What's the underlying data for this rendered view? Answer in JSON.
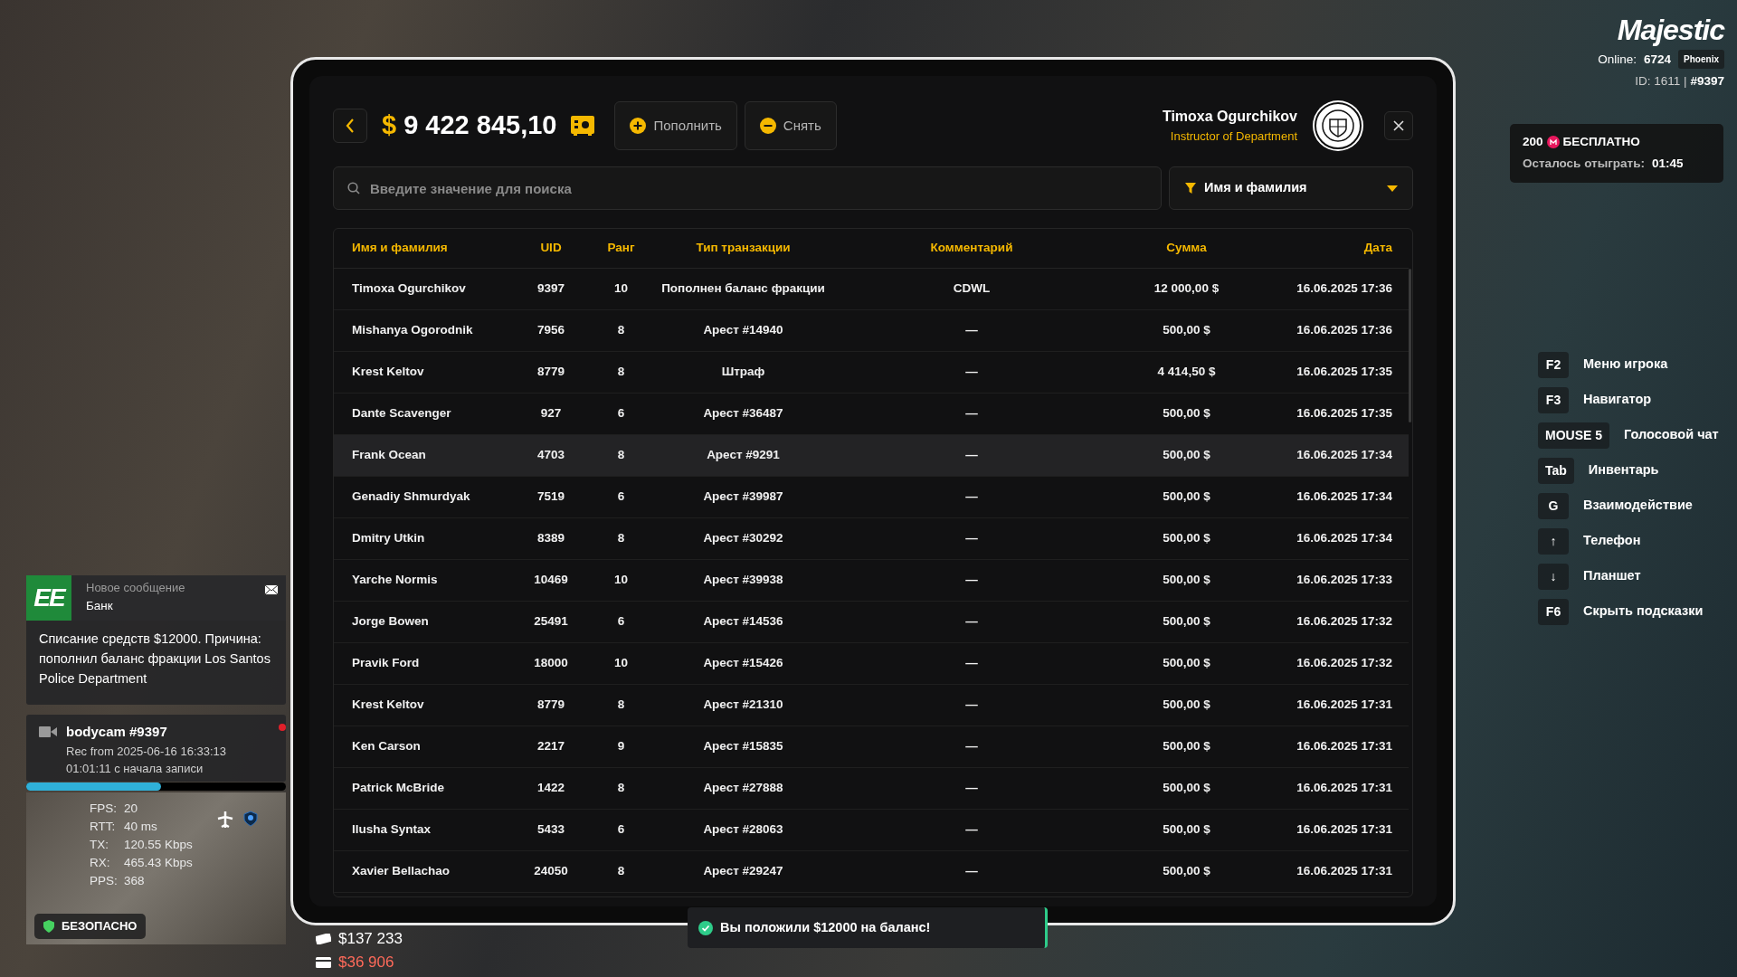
{
  "tablet": {
    "balance_currency": "$",
    "balance": "9 422 845,10",
    "buttons": [
      {
        "kind": "deposit",
        "label": "Пополнить"
      },
      {
        "kind": "withdraw",
        "label": "Снять"
      }
    ],
    "user": {
      "name": "Timoxa Ogurchikov",
      "role": "Instructor of Department"
    },
    "search": {
      "placeholder": "Введите значение для поиска"
    },
    "filter": {
      "value": "Имя и фамилия"
    },
    "table": {
      "columns": [
        "Имя и фамилия",
        "UID",
        "Ранг",
        "Тип транзакции",
        "Комментарий",
        "Сумма",
        "Дата"
      ],
      "rows": [
        {
          "selected": false,
          "cells": [
            "Timoxa Ogurchikov",
            "9397",
            "10",
            "Пополнен баланс фракции",
            "CDWL",
            "12 000,00 $",
            "16.06.2025 17:36"
          ]
        },
        {
          "selected": false,
          "cells": [
            "Mishanya Ogorodnik",
            "7956",
            "8",
            "Арест #14940",
            "—",
            "500,00 $",
            "16.06.2025 17:36"
          ]
        },
        {
          "selected": false,
          "cells": [
            "Krest Keltov",
            "8779",
            "8",
            "Штраф",
            "—",
            "4 414,50 $",
            "16.06.2025 17:35"
          ]
        },
        {
          "selected": false,
          "cells": [
            "Dante Scavenger",
            "927",
            "6",
            "Арест #36487",
            "—",
            "500,00 $",
            "16.06.2025 17:35"
          ]
        },
        {
          "selected": true,
          "cells": [
            "Frank Ocean",
            "4703",
            "8",
            "Арест #9291",
            "—",
            "500,00 $",
            "16.06.2025 17:34"
          ]
        },
        {
          "selected": false,
          "cells": [
            "Genadiy Shmurdyak",
            "7519",
            "6",
            "Арест #39987",
            "—",
            "500,00 $",
            "16.06.2025 17:34"
          ]
        },
        {
          "selected": false,
          "cells": [
            "Dmitry Utkin",
            "8389",
            "8",
            "Арест #30292",
            "—",
            "500,00 $",
            "16.06.2025 17:34"
          ]
        },
        {
          "selected": false,
          "cells": [
            "Yarche Normis",
            "10469",
            "10",
            "Арест #39938",
            "—",
            "500,00 $",
            "16.06.2025 17:33"
          ]
        },
        {
          "selected": false,
          "cells": [
            "Jorge Bowen",
            "25491",
            "6",
            "Арест #14536",
            "—",
            "500,00 $",
            "16.06.2025 17:32"
          ]
        },
        {
          "selected": false,
          "cells": [
            "Pravik Ford",
            "18000",
            "10",
            "Арест #15426",
            "—",
            "500,00 $",
            "16.06.2025 17:32"
          ]
        },
        {
          "selected": false,
          "cells": [
            "Krest Keltov",
            "8779",
            "8",
            "Арест #21310",
            "—",
            "500,00 $",
            "16.06.2025 17:31"
          ]
        },
        {
          "selected": false,
          "cells": [
            "Ken Carson",
            "2217",
            "9",
            "Арест #15835",
            "—",
            "500,00 $",
            "16.06.2025 17:31"
          ]
        },
        {
          "selected": false,
          "cells": [
            "Patrick McBride",
            "1422",
            "8",
            "Арест #27888",
            "—",
            "500,00 $",
            "16.06.2025 17:31"
          ]
        },
        {
          "selected": false,
          "cells": [
            "Ilusha Syntax",
            "5433",
            "6",
            "Арест #28063",
            "—",
            "500,00 $",
            "16.06.2025 17:31"
          ]
        },
        {
          "selected": false,
          "cells": [
            "Xavier Bellachao",
            "24050",
            "8",
            "Арест #29247",
            "—",
            "500,00 $",
            "16.06.2025 17:31"
          ]
        }
      ]
    }
  },
  "notification": {
    "logo_text": "EE",
    "title": "Новое сообщение",
    "sender": "Банк",
    "message": "Списание средств $12000. Причина: пополнил баланс фракции Los Santos Police Department"
  },
  "bodycam": {
    "title": "bodycam #9397",
    "recorded": "Rec from 2025-06-16 16:33:13",
    "elapsed": "01:01:11 с начала записи",
    "level": 0.52
  },
  "netstats": [
    {
      "label": "FPS:",
      "value": "20"
    },
    {
      "label": "RTT:",
      "value": "40 ms"
    },
    {
      "label": "TX:",
      "value": "120.55 Kbps"
    },
    {
      "label": "RX:",
      "value": "465.43 Kbps"
    },
    {
      "label": "PPS:",
      "value": "368"
    }
  ],
  "zone": "БЕЗОПАСНО",
  "money": [
    {
      "kind": "cash",
      "value": "$137 233"
    },
    {
      "kind": "card",
      "value": "$36 906"
    }
  ],
  "toast": "Вы положили $12000 на баланс!",
  "hud": {
    "logo": "Majestic",
    "online_label": "Online:",
    "online": "6724",
    "server": "Phoenix",
    "id": "ID: 1611 |",
    "account": "#9397",
    "promo_amount": "200",
    "promo_label": "БЕСПЛАТНО",
    "remaining_label": "Осталось отыграть:",
    "remaining": "01:45"
  },
  "hints": [
    {
      "key": "F2",
      "label": "Меню игрока"
    },
    {
      "key": "F3",
      "label": "Навигатор"
    },
    {
      "key": "MOUSE 5",
      "label": "Голосовой чат"
    },
    {
      "key": "Tab",
      "label": "Инвентарь"
    },
    {
      "key": "G",
      "label": "Взаимодействие"
    },
    {
      "key": "↑",
      "label": "Телефон"
    },
    {
      "key": "↓",
      "label": "Планшет"
    },
    {
      "key": "F6",
      "label": "Скрыть подсказки"
    }
  ]
}
